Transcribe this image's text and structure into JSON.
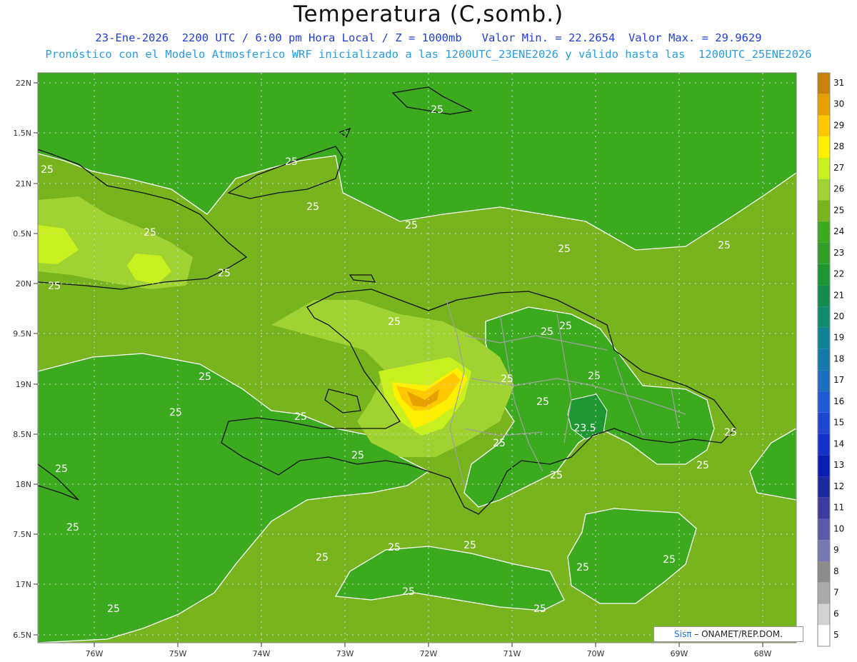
{
  "title": "Temperatura (C,somb.)",
  "subtitle_line1": "23-Ene-2026  2200 UTC / 6:00 pm Hora Local / Z = 1000mb   Valor Min. = 22.2654  Valor Max. = 29.9629",
  "subtitle_line2": "Pronóstico con el Modelo Atmosferico WRF inicializado a las 1200UTC_23ENE2026 y válido hasta las  1200UTC_25ENE2026",
  "lat_labels": [
    "22N",
    "1.5N",
    "21N",
    "0.5N",
    "20N",
    "9.5N",
    "19N",
    "8.5N",
    "18N",
    "7.5N",
    "17N",
    "6.5N"
  ],
  "lon_labels": [
    "76W",
    "75W",
    "74W",
    "73W",
    "72W",
    "71W",
    "70W",
    "69W",
    "68W"
  ],
  "contour_labels": [
    "25",
    "25",
    "25",
    "25",
    "25",
    "25",
    "25",
    "25",
    "25",
    "25",
    "25",
    "25",
    "25",
    "25",
    "25",
    "25",
    "25",
    "25",
    "25",
    "25",
    "25",
    "25",
    "25",
    "25",
    "25",
    "25",
    "25",
    "25",
    "25",
    "25",
    "23.5"
  ],
  "colorbar": {
    "levels": [
      "31",
      "30",
      "29",
      "28",
      "27",
      "26",
      "25",
      "24",
      "23",
      "22",
      "21",
      "20",
      "19",
      "18",
      "17",
      "16",
      "15",
      "14",
      "13",
      "12",
      "11",
      "10",
      "9",
      "8",
      "7",
      "6",
      "5"
    ],
    "colors": [
      "#c8820a",
      "#e6a000",
      "#ffc800",
      "#fff000",
      "#c8f01e",
      "#a0d232",
      "#78b41e",
      "#3caa1e",
      "#32a028",
      "#1e9632",
      "#148c50",
      "#0f8c6e",
      "#0f8296",
      "#1478aa",
      "#1e6ebe",
      "#1e5ad2",
      "#1e46d2",
      "#1432c8",
      "#0a1eb4",
      "#1e28a0",
      "#3c3ca0",
      "#5a5aaa",
      "#7878b4",
      "#8c8c8c",
      "#aaaaaa",
      "#d2d2d2",
      "#ffffff"
    ]
  },
  "credit": {
    "sis": "Sisπ",
    "rest": "– ONAMET/REP.DOM."
  }
}
